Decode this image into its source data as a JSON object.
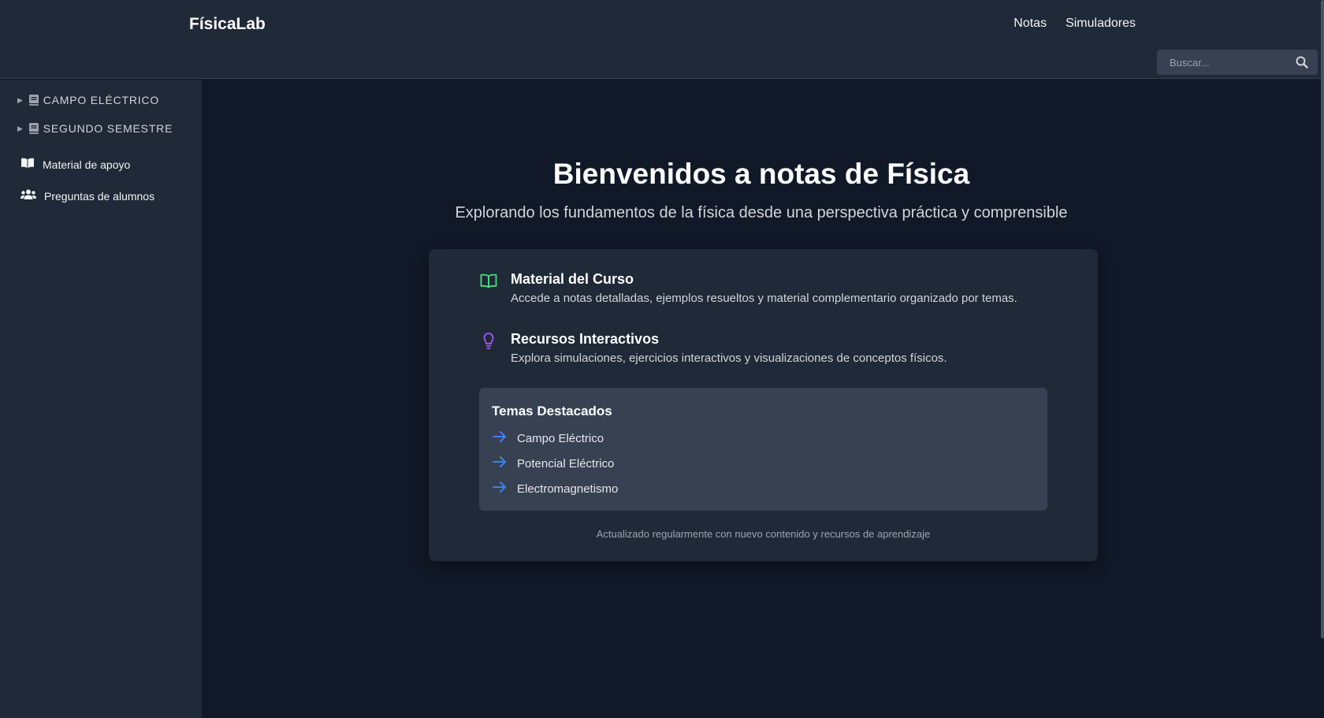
{
  "header": {
    "brand": "FísicaLab",
    "nav": [
      "Notas",
      "Simuladores"
    ],
    "search_placeholder": "Buscar..."
  },
  "sidebar": {
    "sections": [
      {
        "label": "CAMPO ELÉCTRICO",
        "icon": "book-icon"
      },
      {
        "label": "SEGUNDO SEMESTRE",
        "icon": "book-icon"
      }
    ],
    "links": [
      {
        "label": "Material de apoyo",
        "icon": "book-open-icon"
      },
      {
        "label": "Preguntas de alumnos",
        "icon": "users-icon"
      }
    ]
  },
  "main": {
    "title": "Bienvenidos a notas de Física",
    "subtitle": "Explorando los fundamentos de la física desde una perspectiva práctica y comprensible",
    "features": [
      {
        "title": "Material del Curso",
        "description": "Accede a notas detalladas, ejemplos resueltos y material complementario organizado por temas.",
        "icon": "book-open-icon",
        "color": "#4ade80"
      },
      {
        "title": "Recursos Interactivos",
        "description": "Explora simulaciones, ejercicios interactivos y visualizaciones de conceptos físicos.",
        "icon": "lightbulb-icon",
        "color": "#a855f7"
      }
    ],
    "topics": {
      "title": "Temas Destacados",
      "items": [
        "Campo Eléctrico",
        "Potencial Eléctrico",
        "Electromagnetismo"
      ],
      "icon": "arrow-right-icon",
      "icon_color": "#3b82f6"
    },
    "footer": "Actualizado regularmente con nuevo contenido y recursos de aprendizaje"
  },
  "colors": {
    "background": "#111827",
    "panel": "#1f2937",
    "panel_inner": "#374151"
  }
}
